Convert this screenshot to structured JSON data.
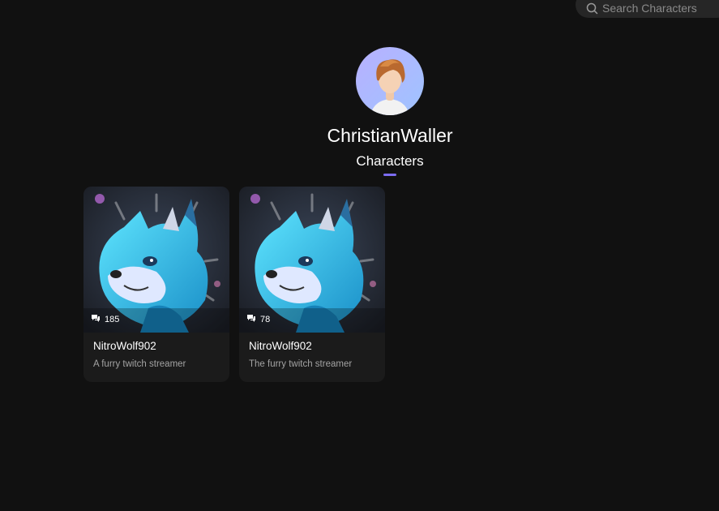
{
  "search": {
    "placeholder": "Search Characters",
    "icon": "search-icon"
  },
  "profile": {
    "username": "ChristianWaller",
    "avatar_icon": "user-avatar"
  },
  "tabs": [
    {
      "label": "Characters",
      "active": true
    }
  ],
  "colors": {
    "background": "#111111",
    "card": "#1b1b1b",
    "accent": "#7c6cf0",
    "muted_text": "#a3a3a3"
  },
  "characters": [
    {
      "name": "NitroWolf902",
      "description": "A furry twitch streamer",
      "chat_count": "185",
      "count_icon": "chat-bubbles-icon"
    },
    {
      "name": "NitroWolf902",
      "description": "The furry twitch streamer",
      "chat_count": "78",
      "count_icon": "chat-bubbles-icon"
    }
  ]
}
